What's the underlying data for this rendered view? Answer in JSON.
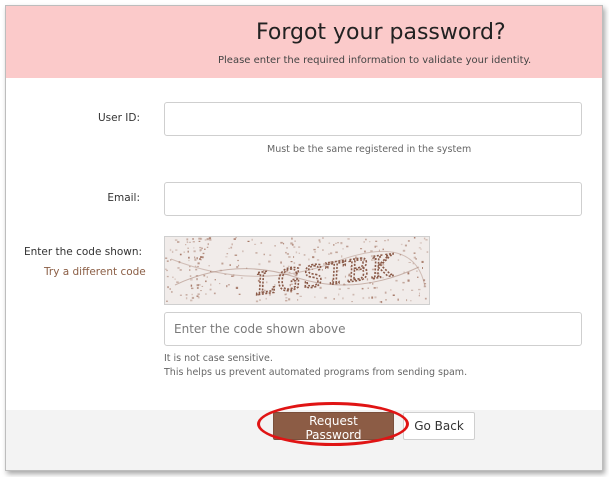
{
  "header": {
    "title": "Forgot your password?",
    "subtitle": "Please enter the required information to validate your identity."
  },
  "form": {
    "user_id": {
      "label": "User ID:",
      "value": "",
      "hint": "Must be the same registered in the system"
    },
    "email": {
      "label": "Email:",
      "value": ""
    },
    "captcha": {
      "label": "Enter the code shown:",
      "refresh_link": "Try a different code",
      "image_text": "LGSTBK",
      "placeholder": "Enter the code shown above",
      "hint_line1": "It is not case sensitive.",
      "hint_line2": "This helps us prevent automated programs from sending spam."
    }
  },
  "actions": {
    "request_label": "Request Password",
    "back_label": "Go Back"
  },
  "colors": {
    "header_bg": "#fbcaca",
    "accent": "#8c5c45",
    "highlight": "#e01414"
  }
}
